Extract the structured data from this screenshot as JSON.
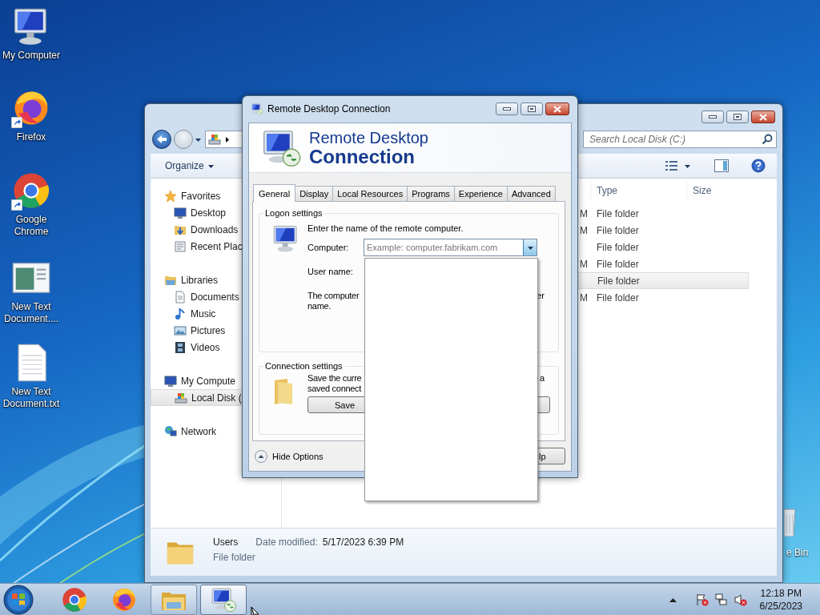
{
  "desktop_icons": [
    {
      "label": "My Computer",
      "shortcut": false
    },
    {
      "label": "Firefox",
      "shortcut": true
    },
    {
      "label": "Google Chrome",
      "shortcut": true
    },
    {
      "label": "New Text Document....",
      "shortcut": false
    },
    {
      "label": "New Text Document.txt",
      "shortcut": false
    }
  ],
  "recycle_bin": {
    "label": "e Bin"
  },
  "explorer": {
    "search": {
      "placeholder": "Search Local Disk (C:)"
    },
    "organize": "Organize",
    "nav": [
      {
        "label": "Favorites",
        "selected": false,
        "children": [
          {
            "label": "Desktop",
            "selected": false
          },
          {
            "label": "Downloads",
            "selected": false
          },
          {
            "label": "Recent Plac",
            "selected": false
          }
        ]
      },
      {
        "label": "Libraries",
        "selected": false,
        "children": [
          {
            "label": "Documents",
            "selected": false
          },
          {
            "label": "Music",
            "selected": false
          },
          {
            "label": "Pictures",
            "selected": false
          },
          {
            "label": "Videos",
            "selected": false
          }
        ]
      },
      {
        "label": "My Compute",
        "selected": false,
        "children": [
          {
            "label": "Local Disk (",
            "selected": true
          }
        ]
      },
      {
        "label": "Network",
        "selected": false
      }
    ],
    "columns": [
      "Type",
      "Size"
    ],
    "rows": [
      {
        "date": "M",
        "type": "File folder",
        "selected": false
      },
      {
        "date": "M",
        "type": "File folder",
        "selected": false
      },
      {
        "type": "File folder",
        "selected": false
      },
      {
        "date": "M",
        "type": "File folder",
        "selected": false
      },
      {
        "type": "File folder",
        "selected": true
      },
      {
        "date": "M",
        "type": "File folder",
        "selected": false
      }
    ],
    "details": {
      "name": "Users",
      "type": "File folder",
      "date_label": "Date modified:",
      "date": "5/17/2023 6:39 PM"
    }
  },
  "rdp": {
    "title": "Remote Desktop Connection",
    "banner_line1": "Remote Desktop",
    "banner_line2": "Connection",
    "tabs": [
      {
        "label": "General",
        "selected": true
      },
      {
        "label": "Display",
        "selected": false
      },
      {
        "label": "Local Resources",
        "selected": false
      },
      {
        "label": "Programs",
        "selected": false
      },
      {
        "label": "Experience",
        "selected": false
      },
      {
        "label": "Advanced",
        "selected": false
      }
    ],
    "logon": {
      "legend": "Logon settings",
      "prompt": "Enter the name of the remote computer.",
      "computer_label": "Computer:",
      "computer_placeholder": "Example: computer.fabrikam.com",
      "computer_expanded": true,
      "username_label": "User name:",
      "note_left": [
        "The computer",
        "name."
      ],
      "note_right": "er"
    },
    "connection": {
      "legend": "Connection settings",
      "note_left": [
        "Save the curre",
        "saved connect"
      ],
      "note_right": "a",
      "save_button": "Save"
    },
    "hide_options": "Hide Options",
    "help_fragment": "lp"
  },
  "taskbar": {
    "items": [
      {
        "running": false,
        "active": false
      },
      {
        "running": false,
        "active": false
      },
      {
        "running": true,
        "active": false
      },
      {
        "running": true,
        "active": true
      }
    ],
    "clock": {
      "time": "12:18 PM",
      "date": "6/25/2023"
    }
  }
}
